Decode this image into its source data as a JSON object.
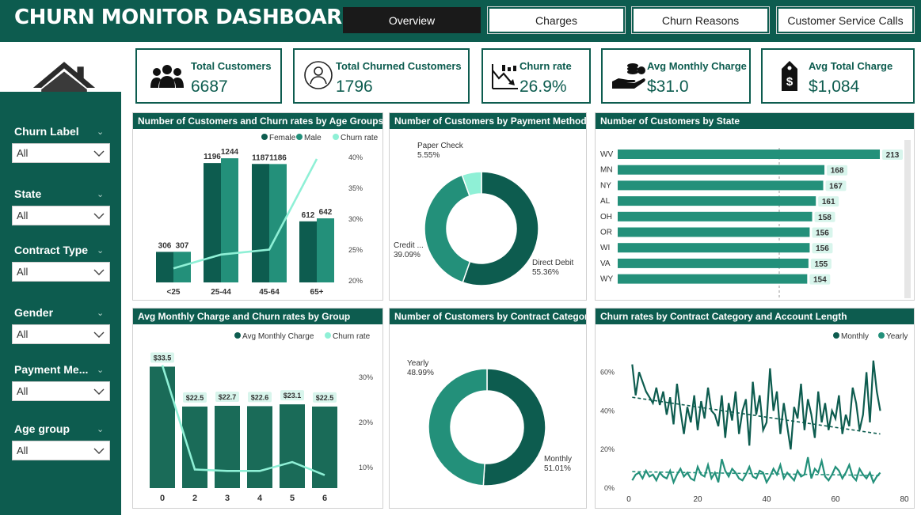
{
  "header": {
    "title": "CHURN MONITOR DASHBOARD",
    "tabs": [
      {
        "label": "Overview",
        "active": true
      },
      {
        "label": "Charges",
        "active": false
      },
      {
        "label": "Churn Reasons",
        "active": false
      },
      {
        "label": "Customer Service Calls",
        "active": false
      }
    ]
  },
  "filters": [
    {
      "label": "Churn Label",
      "value": "All"
    },
    {
      "label": "State",
      "value": "All"
    },
    {
      "label": "Contract Type",
      "value": "All"
    },
    {
      "label": "Gender",
      "value": "All"
    },
    {
      "label": "Payment Me...",
      "value": "All"
    },
    {
      "label": "Age group",
      "value": "All"
    }
  ],
  "kpis": [
    {
      "title": "Total Customers",
      "value": "6687",
      "icon": "customers-icon"
    },
    {
      "title": "Total Churned Customers",
      "value": "1796",
      "icon": "churned-user-icon"
    },
    {
      "title": "Churn rate",
      "value": "26.9%",
      "icon": "churn-rate-icon"
    },
    {
      "title": "Avg Monthly Charge",
      "value": "$31.0",
      "icon": "coins-hand-icon"
    },
    {
      "title": "Avg Total Charge",
      "value": "$1,084",
      "icon": "price-tag-icon"
    }
  ],
  "colors": {
    "primary": "#0d5c4f",
    "female": "#0d5c4f",
    "male": "#23907a",
    "churn": "#8ff0d6",
    "highlight": "#d8f5ec"
  },
  "chart_data": [
    {
      "id": "age",
      "type": "bar",
      "title": "Number of Customers and Churn rates by Age Groups",
      "categories": [
        "<25",
        "25-44",
        "45-64",
        "65+"
      ],
      "series": [
        {
          "name": "Female",
          "values": [
            306,
            1196,
            1187,
            612
          ]
        },
        {
          "name": "Male",
          "values": [
            307,
            1244,
            1186,
            642
          ]
        },
        {
          "name": "Churn rate",
          "values": [
            22,
            24.2,
            25,
            39.5
          ]
        }
      ],
      "y2_ticks": [
        "40%",
        "35%",
        "30%",
        "25%",
        "20%"
      ],
      "y2lim": [
        20,
        40
      ]
    },
    {
      "id": "payment",
      "type": "pie",
      "title": "Number of Customers by Payment Method",
      "slices": [
        {
          "name": "Direct Debit",
          "label": "55.36%",
          "value": 55.36
        },
        {
          "name": "Credit ...",
          "label": "39.09%",
          "value": 39.09
        },
        {
          "name": "Paper Check",
          "label": "5.55%",
          "value": 5.55
        }
      ]
    },
    {
      "id": "state",
      "type": "bar",
      "orientation": "horizontal",
      "title": "Number of Customers by State",
      "categories": [
        "WV",
        "MN",
        "NY",
        "AL",
        "OH",
        "OR",
        "WI",
        "VA",
        "WY"
      ],
      "values": [
        213,
        168,
        167,
        161,
        158,
        156,
        156,
        155,
        154
      ],
      "xlim": [
        0,
        213
      ]
    },
    {
      "id": "group",
      "type": "bar",
      "title": "Avg Monthly Charge and Churn rates by Group",
      "categories": [
        "0",
        "2",
        "3",
        "4",
        "5",
        "6"
      ],
      "series": [
        {
          "name": "Avg Monthly Charge",
          "values": [
            33.5,
            22.5,
            22.7,
            22.6,
            23.1,
            22.5
          ],
          "labels": [
            "$33.5",
            "$22.5",
            "$22.7",
            "$22.6",
            "$23.1",
            "$22.5"
          ]
        },
        {
          "name": "Churn rate",
          "values": [
            33,
            5,
            4.6,
            4.6,
            7,
            3.5
          ]
        }
      ],
      "y2_ticks": [
        "30%",
        "20%",
        "10%"
      ],
      "y2lim": [
        0,
        34
      ]
    },
    {
      "id": "contract",
      "type": "pie",
      "title": "Number of Customers by Contract Category",
      "slices": [
        {
          "name": "Monthly",
          "label": "51.01%",
          "value": 51.01
        },
        {
          "name": "Yearly",
          "label": "48.99%",
          "value": 48.99
        }
      ]
    },
    {
      "id": "length",
      "type": "line",
      "title": "Churn rates by Contract Category and Account Length",
      "series": [
        {
          "name": "Monthly",
          "values": [
            64,
            48,
            60,
            55,
            50,
            47,
            44,
            52,
            43,
            50,
            38,
            47,
            33,
            54,
            40,
            28,
            42,
            34,
            48,
            30,
            45,
            36,
            52,
            40,
            38,
            32,
            48,
            26,
            44,
            35,
            50,
            28,
            40,
            46,
            22,
            55,
            38,
            48,
            30,
            34,
            62,
            40,
            50,
            28,
            44,
            32,
            20,
            42,
            36,
            54,
            30,
            46,
            38,
            26,
            50,
            34,
            44,
            30,
            40,
            36,
            48,
            28,
            38,
            32,
            52,
            44,
            30,
            38,
            60,
            34,
            66,
            50,
            40
          ]
        },
        {
          "name": "Yearly",
          "values": [
            4,
            7,
            8,
            5,
            9,
            6,
            7,
            4,
            8,
            6,
            5,
            9,
            3,
            7,
            10,
            6,
            8,
            5,
            4,
            11,
            7,
            6,
            12,
            5,
            8,
            3,
            15,
            9,
            6,
            10,
            8,
            5,
            4,
            7,
            11,
            6,
            5,
            9,
            8,
            3,
            6,
            10,
            7,
            12,
            5,
            8,
            6,
            4,
            9,
            6,
            7,
            16,
            5,
            10,
            8,
            14,
            6,
            4,
            7,
            11,
            9,
            5,
            8,
            12,
            6,
            4,
            10,
            7,
            5,
            8,
            3,
            6,
            8
          ]
        },
        {
          "name": "Monthly trend",
          "values": [
            47,
            28
          ]
        },
        {
          "name": "Yearly trend",
          "values": [
            8.5,
            6.5
          ]
        }
      ],
      "x_ticks": [
        "0",
        "20",
        "40",
        "60",
        "80"
      ],
      "y_ticks": [
        "60%",
        "40%",
        "20%",
        "0%"
      ],
      "xlim": [
        0,
        80
      ],
      "ylim": [
        0,
        70
      ]
    }
  ]
}
